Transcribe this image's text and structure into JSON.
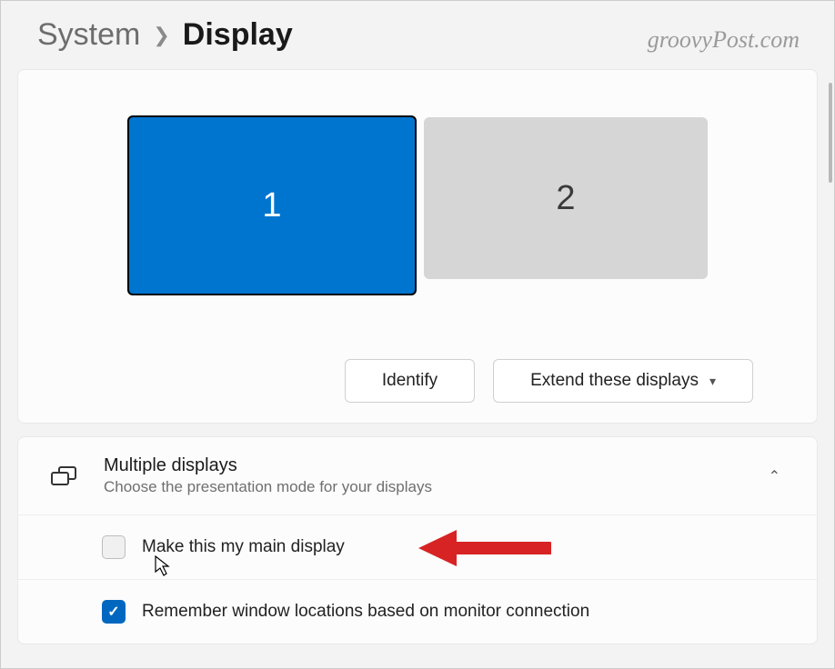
{
  "breadcrumb": {
    "parent": "System",
    "current": "Display"
  },
  "watermark": "groovyPost.com",
  "monitors": [
    {
      "label": "1",
      "selected": true
    },
    {
      "label": "2",
      "selected": false
    }
  ],
  "actions": {
    "identify": "Identify",
    "extend": "Extend these displays"
  },
  "multiple": {
    "title": "Multiple displays",
    "subtitle": "Choose the presentation mode for your displays"
  },
  "options": {
    "main_display": "Make this my main display",
    "remember_windows": "Remember window locations based on monitor connection"
  }
}
